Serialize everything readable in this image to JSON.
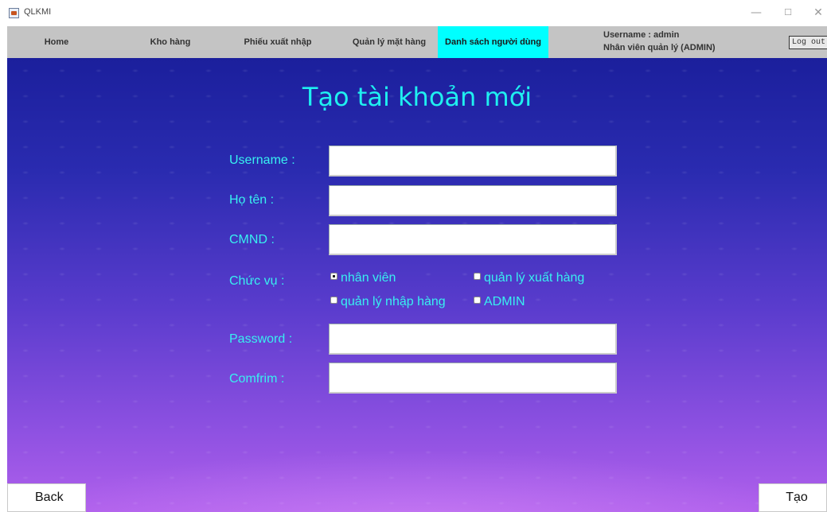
{
  "window": {
    "title": "QLKMI",
    "minimize": "—",
    "maximize": "☐",
    "close": "✕"
  },
  "nav": {
    "home": "Home",
    "kho_hang": "Kho hàng",
    "phieu_xuat_nhap": "Phiếu xuất nhập",
    "quan_ly_mat_hang": "Quản lý mặt hàng",
    "danh_sach_nguoi_dung": "Danh sách người dùng",
    "active": "Danh sách người dùng",
    "active_color": "#00ffff"
  },
  "user": {
    "username_line": "Username : admin",
    "role_line": "Nhân viên quản lý (ADMIN)",
    "logout": "Log out"
  },
  "form": {
    "title": "Tạo tài khoản mới",
    "username_label": "Username :",
    "username_value": "",
    "hoten_label": "Họ tên :",
    "hoten_value": "",
    "cmnd_label": "CMND :",
    "cmnd_value": "",
    "chucvu_label": "Chức vụ :",
    "roles": [
      {
        "label": "nhân viên",
        "checked": true
      },
      {
        "label": "quản lý xuất hàng",
        "checked": false
      },
      {
        "label": "quản lý nhập hàng",
        "checked": false
      },
      {
        "label": "ADMIN",
        "checked": false
      }
    ],
    "password_label": "Password :",
    "password_value": "",
    "confirm_label": "Comfrim :",
    "confirm_value": ""
  },
  "buttons": {
    "back": "Back",
    "create": "Tạo"
  },
  "colors": {
    "label_cyan": "#38f0f0",
    "title_cyan": "#1ff0f0",
    "bg_top": "#1b1f9c",
    "bg_bottom": "#b060ec"
  }
}
